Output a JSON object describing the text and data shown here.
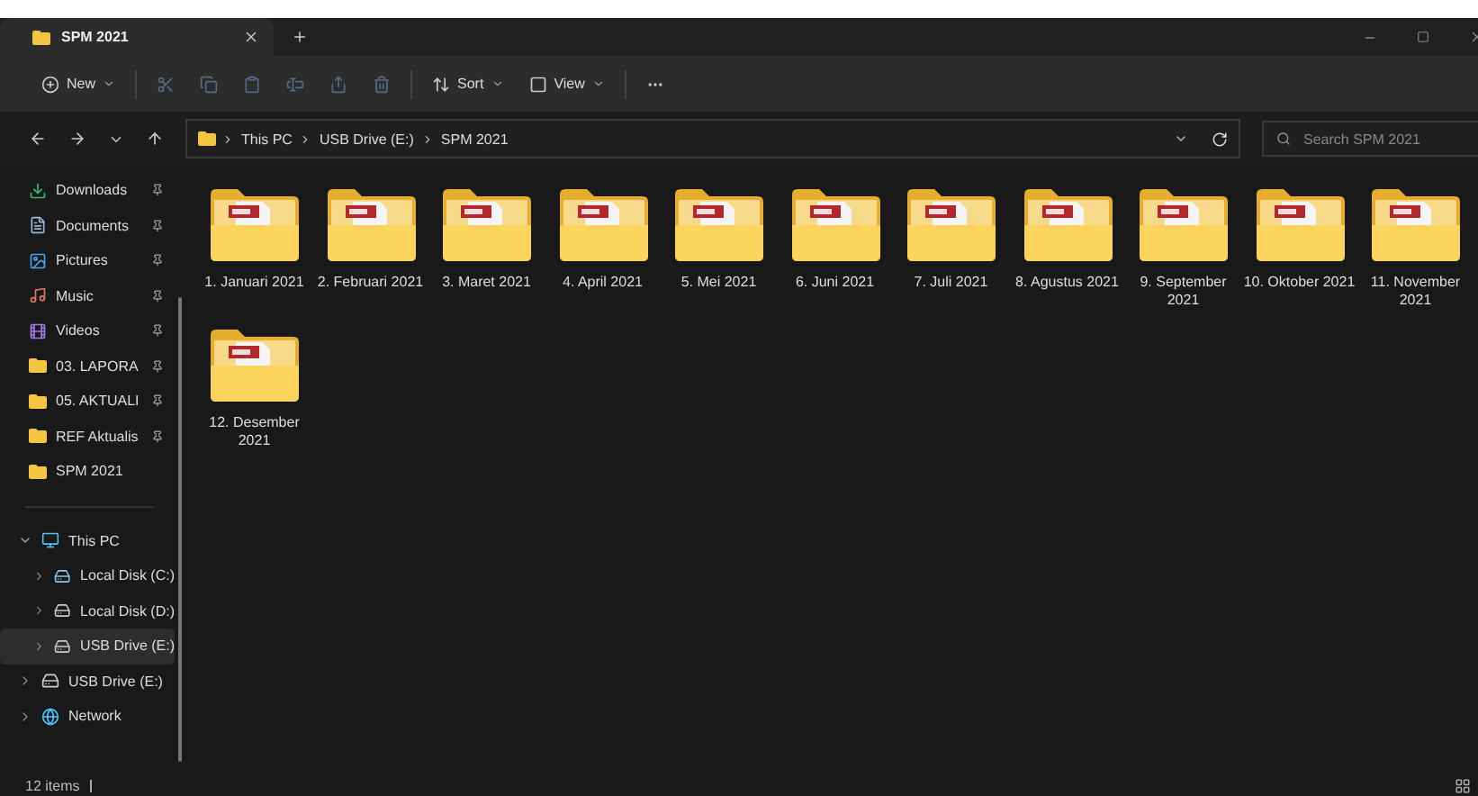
{
  "window": {
    "tab_title": "SPM 2021"
  },
  "toolbar": [
    {
      "kind": "new",
      "label": "New",
      "disabled": false
    },
    {
      "kind": "cut",
      "disabled": true
    },
    {
      "kind": "copy",
      "disabled": true
    },
    {
      "kind": "paste",
      "disabled": true
    },
    {
      "kind": "rename",
      "disabled": true
    },
    {
      "kind": "share",
      "disabled": true
    },
    {
      "kind": "delete",
      "disabled": true
    },
    {
      "kind": "sort",
      "label": "Sort",
      "disabled": false
    },
    {
      "kind": "view",
      "label": "View",
      "disabled": false
    },
    {
      "kind": "more",
      "disabled": false
    }
  ],
  "address": {
    "path": [
      "This PC",
      "USB Drive (E:)",
      "SPM 2021"
    ]
  },
  "search": {
    "placeholder": "Search SPM 2021"
  },
  "sidebar": {
    "quick_access": [
      {
        "label": "Downloads",
        "kind": "download",
        "pinned": true
      },
      {
        "label": "Documents",
        "kind": "document",
        "pinned": true
      },
      {
        "label": "Pictures",
        "kind": "picture",
        "pinned": true
      },
      {
        "label": "Music",
        "kind": "music",
        "pinned": true
      },
      {
        "label": "Videos",
        "kind": "video",
        "pinned": true
      },
      {
        "label": "03. LAPORA",
        "kind": "folder",
        "pinned": true
      },
      {
        "label": "05. AKTUALI",
        "kind": "folder",
        "pinned": true
      },
      {
        "label": "REF Aktualis",
        "kind": "folder",
        "pinned": true
      },
      {
        "label": "SPM 2021",
        "kind": "folder",
        "pinned": false
      }
    ],
    "tree": [
      {
        "label": "This PC",
        "kind": "pc",
        "expanded": true,
        "selected": false,
        "children": [
          {
            "label": "Local Disk (C:)",
            "kind": "system-drive",
            "expanded": false,
            "selected": false
          },
          {
            "label": "Local Disk (D:)",
            "kind": "drive",
            "expanded": false,
            "selected": false
          },
          {
            "label": "USB Drive (E:)",
            "kind": "drive",
            "expanded": false,
            "selected": true
          }
        ]
      },
      {
        "label": "USB Drive (E:)",
        "kind": "drive",
        "expanded": false,
        "selected": false
      },
      {
        "label": "Network",
        "kind": "network",
        "expanded": false,
        "selected": false
      }
    ]
  },
  "files": [
    {
      "name": "1. Januari 2021"
    },
    {
      "name": "2. Februari 2021"
    },
    {
      "name": "3. Maret 2021"
    },
    {
      "name": "4. April 2021"
    },
    {
      "name": "5. Mei 2021"
    },
    {
      "name": "6. Juni 2021"
    },
    {
      "name": "7. Juli 2021"
    },
    {
      "name": "8. Agustus 2021"
    },
    {
      "name": "9. September 2021"
    },
    {
      "name": "10. Oktober 2021"
    },
    {
      "name": "11. November 2021"
    },
    {
      "name": "12. Desember 2021"
    }
  ],
  "status_bar": {
    "count": "12 items"
  }
}
